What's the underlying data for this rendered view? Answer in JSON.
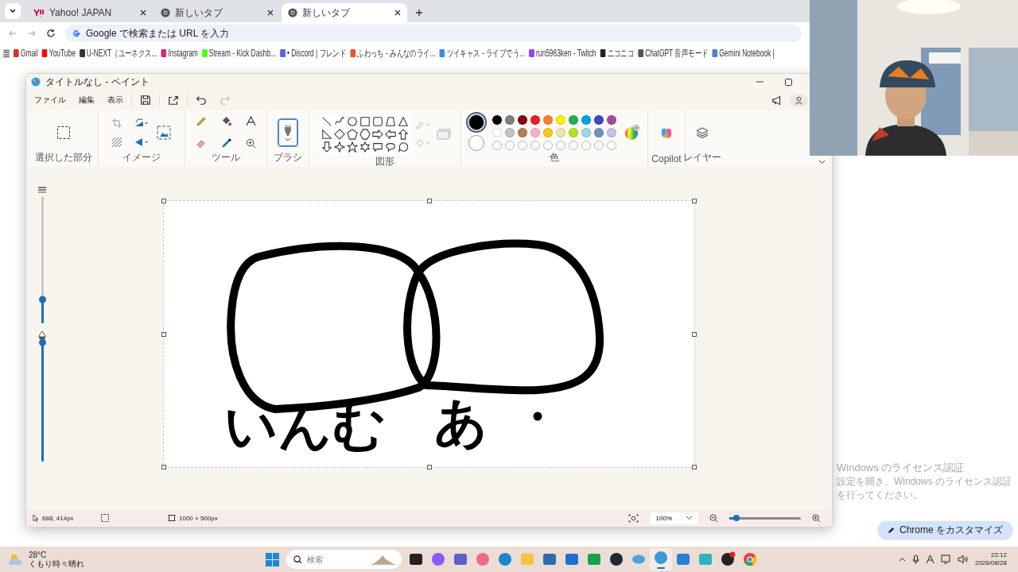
{
  "browser": {
    "tabs": [
      {
        "title": "Yahoo! JAPAN",
        "kind": "yahoo",
        "selected": false
      },
      {
        "title": "新しいタブ",
        "kind": "chrome",
        "selected": false
      },
      {
        "title": "新しいタブ",
        "kind": "chrome",
        "selected": true
      }
    ],
    "omnibox": {
      "placeholder": "Google で検索または URL を入力"
    },
    "bookmarks": [
      {
        "title": "Gmail",
        "color": "#d93025"
      },
      {
        "title": "YouTube",
        "color": "#ff0000"
      },
      {
        "title": "U-NEXT（ユーネクス...",
        "color": "#333333"
      },
      {
        "title": "Instagram",
        "color": "#d62976"
      },
      {
        "title": "Stream - Kick Dashb...",
        "color": "#53fc18"
      },
      {
        "title": "• Discord | フレンド",
        "color": "#5865f2"
      },
      {
        "title": "ふわっち - みんなのライ...",
        "color": "#e8542c"
      },
      {
        "title": "ツイキャス - ライブでう...",
        "color": "#3a8ee6"
      },
      {
        "title": "run5963ken - Twitch",
        "color": "#9146ff"
      },
      {
        "title": "ニコニコ",
        "color": "#222222"
      },
      {
        "title": "ChatGPT 音声モード",
        "color": "#555555"
      },
      {
        "title": "Gemini Notebook |",
        "color": "#4a7fd8"
      }
    ],
    "customize_button": "Chrome をカスタマイズ"
  },
  "paint": {
    "title": "タイトルなし - ペイント",
    "menu": [
      "ファイル",
      "編集",
      "表示"
    ],
    "quick_actions": [
      {
        "kind": "save",
        "disabled": false
      },
      {
        "kind": "share",
        "disabled": false
      },
      {
        "kind": "undo",
        "disabled": false
      },
      {
        "kind": "redo",
        "disabled": true
      }
    ],
    "group_labels": {
      "selection": "選択した部分",
      "image": "イメージ",
      "tools": "ツール",
      "brushes": "ブラシ",
      "shapes": "図形",
      "colors": "色",
      "copilot": "Copilot",
      "layers": "レイヤー"
    },
    "brush": {
      "selected": true
    },
    "primary_color": {
      "color": "#000000",
      "selected": true
    },
    "secondary_color": {
      "color": "#ffffff",
      "selected": false
    },
    "palette": [
      {
        "color": "#000000"
      },
      {
        "color": "#7f7f7f"
      },
      {
        "color": "#880015"
      },
      {
        "color": "#ed1c24"
      },
      {
        "color": "#ff7f27"
      },
      {
        "color": "#fff200"
      },
      {
        "color": "#22b14c"
      },
      {
        "color": "#00a2e8"
      },
      {
        "color": "#3f48cc"
      },
      {
        "color": "#a349a4"
      },
      {
        "color": "#ffffff"
      },
      {
        "color": "#c3c3c3"
      },
      {
        "color": "#b97a57"
      },
      {
        "color": "#ffaec9"
      },
      {
        "color": "#ffc90e"
      },
      {
        "color": "#efe4b0"
      },
      {
        "color": "#b5e61d"
      },
      {
        "color": "#99d9ea"
      },
      {
        "color": "#7092be"
      },
      {
        "color": "#c8bfe7"
      }
    ],
    "side_sliders": [
      {
        "kind": "size",
        "level": 0.19
      },
      {
        "kind": "opacity",
        "level": 1.0
      }
    ],
    "canvas": {
      "handwriting": [
        {
          "text": "いんむ"
        },
        {
          "text": "あ"
        }
      ]
    },
    "status": {
      "cursor": "688, 414px",
      "size": "1000 × 500px",
      "zoom": "100%",
      "zoom_slider": {
        "level": 0.1
      }
    }
  },
  "watermark": {
    "title": "Windows のライセンス認証",
    "message": "設定を開き、Windows のライセンス認証を行ってください。"
  },
  "taskbar": {
    "weather": {
      "temperature": "28°C",
      "condition": "くもり時々晴れ"
    },
    "search": {
      "placeholder": "検索"
    },
    "apps": [
      {
        "kind": "taskview",
        "active": false
      },
      {
        "kind": "copilot",
        "active": false
      },
      {
        "kind": "teams",
        "active": false
      },
      {
        "kind": "lips",
        "active": false
      },
      {
        "kind": "edge",
        "active": false
      },
      {
        "kind": "folder",
        "active": false
      },
      {
        "kind": "store",
        "active": false
      },
      {
        "kind": "mail",
        "active": false
      },
      {
        "kind": "xbox",
        "active": false
      },
      {
        "kind": "steam",
        "active": false
      },
      {
        "kind": "bubble",
        "active": false
      },
      {
        "kind": "paint",
        "active": true
      },
      {
        "kind": "photos",
        "active": false
      },
      {
        "kind": "notepad",
        "active": false
      },
      {
        "kind": "obs",
        "active": false
      },
      {
        "kind": "chrome",
        "active": false
      }
    ],
    "time": "22:12",
    "date": "2026/08/28"
  }
}
